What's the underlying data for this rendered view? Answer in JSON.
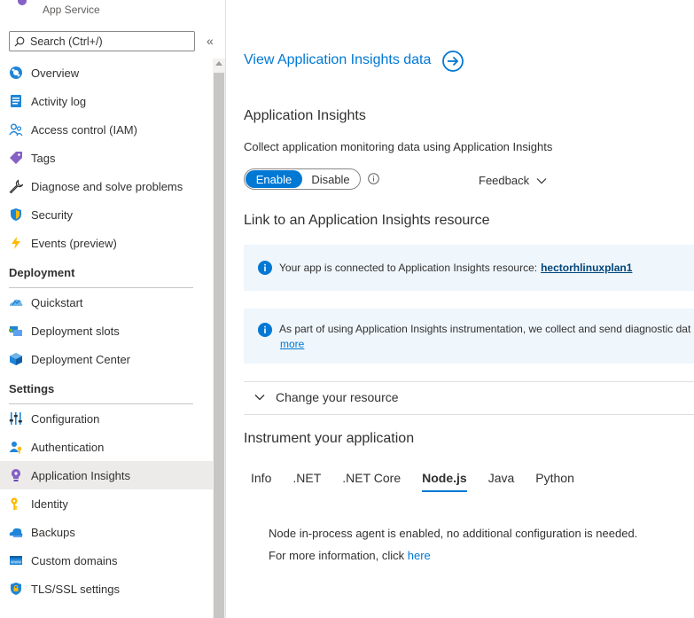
{
  "header": {
    "subtitle": "App Service"
  },
  "search": {
    "placeholder": "Search (Ctrl+/)"
  },
  "sidebar": {
    "collapse_icon": "double-chevron-left-icon",
    "items": [
      {
        "label": "Overview",
        "icon": "overview-icon"
      },
      {
        "label": "Activity log",
        "icon": "activity-log-icon"
      },
      {
        "label": "Access control (IAM)",
        "icon": "iam-icon"
      },
      {
        "label": "Tags",
        "icon": "tag-icon"
      },
      {
        "label": "Diagnose and solve problems",
        "icon": "wrench-icon"
      },
      {
        "label": "Security",
        "icon": "shield-icon"
      },
      {
        "label": "Events (preview)",
        "icon": "lightning-icon"
      }
    ],
    "deployment": {
      "title": "Deployment",
      "items": [
        {
          "label": "Quickstart",
          "icon": "quickstart-icon"
        },
        {
          "label": "Deployment slots",
          "icon": "deployment-slots-icon"
        },
        {
          "label": "Deployment Center",
          "icon": "cube-icon"
        }
      ]
    },
    "settings": {
      "title": "Settings",
      "items": [
        {
          "label": "Configuration",
          "icon": "configuration-icon"
        },
        {
          "label": "Authentication",
          "icon": "authentication-icon"
        },
        {
          "label": "Application Insights",
          "icon": "lightbulb-icon",
          "active": true
        },
        {
          "label": "Identity",
          "icon": "identity-key-icon"
        },
        {
          "label": "Backups",
          "icon": "backup-cloud-icon"
        },
        {
          "label": "Custom domains",
          "icon": "custom-domains-icon"
        },
        {
          "label": "TLS/SSL settings",
          "icon": "tls-shield-icon"
        }
      ]
    }
  },
  "main": {
    "view_link": "View Application Insights data",
    "section_title": "Application Insights",
    "collect_text": "Collect application monitoring data using Application Insights",
    "toggle": {
      "enable": "Enable",
      "disable": "Disable",
      "selected": "Enable"
    },
    "feedback": "Feedback",
    "link_title": "Link to an Application Insights resource",
    "banner_connected": {
      "text": "Your app is connected to Application Insights resource:",
      "resource": "hectorhlinuxplan1"
    },
    "banner_diag": {
      "text": "As part of using Application Insights instrumentation, we collect and send diagnostic dat",
      "more": "more"
    },
    "change_resource": "Change your resource",
    "instrument_title": "Instrument your application",
    "tabs": [
      {
        "label": "Info"
      },
      {
        "label": ".NET"
      },
      {
        "label": ".NET Core"
      },
      {
        "label": "Node.js",
        "active": true
      },
      {
        "label": "Java"
      },
      {
        "label": "Python"
      }
    ],
    "node_text": "Node in-process agent is enabled, no additional configuration is needed.",
    "more_info_text": "For more information, click ",
    "more_info_link": "here"
  },
  "colors": {
    "accent": "#0078d4",
    "banner": "#eff6fc",
    "active_nav": "#edebe9"
  }
}
